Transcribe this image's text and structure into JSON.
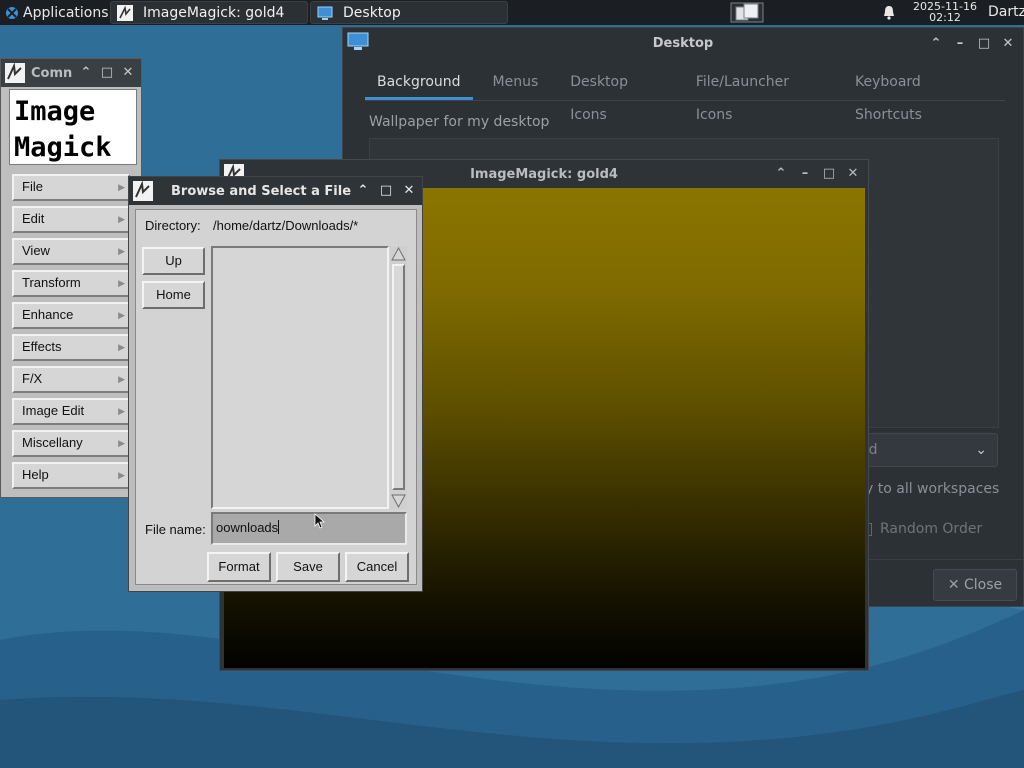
{
  "panel": {
    "applications_label": "Applications",
    "tasks": [
      {
        "label": "ImageMagick: gold4"
      },
      {
        "label": "Desktop"
      }
    ],
    "clock_date": "2025-11-16",
    "clock_time": "02:12",
    "user": "Dartz"
  },
  "desktop_window": {
    "title": "Desktop",
    "tabs": [
      "Background",
      "Menus",
      "Desktop Icons",
      "File/Launcher Icons",
      "Keyboard Shortcuts"
    ],
    "active_tab": "Background",
    "wallpaper_label": "Wallpaper for my desktop",
    "style_value": "ed",
    "apply_all_label": "y to all workspaces",
    "random_order_label": "Random Order",
    "close_label": "✕ Close"
  },
  "gold4_window": {
    "title": "ImageMagick: gold4"
  },
  "command_window": {
    "title": "Comn",
    "logo_lines": [
      "Image",
      "Magick"
    ],
    "menu_items": [
      "File",
      "Edit",
      "View",
      "Transform",
      "Enhance",
      "Effects",
      "F/X",
      "Image Edit",
      "Miscellany",
      "Help"
    ]
  },
  "browse_dialog": {
    "title": "Browse and Select a File",
    "directory_label": "Directory:",
    "directory_value": "/home/dartz/Downloads/*",
    "up_label": "Up",
    "home_label": "Home",
    "file_name_label": "File name:",
    "file_name_value": "oownloads",
    "format_label": "Format",
    "save_label": "Save",
    "cancel_label": "Cancel"
  },
  "colors": {
    "panel_bg": "#1b1f23",
    "desktop_bg": "#2f6e97",
    "accent": "#3d8fd6",
    "gold_top": "#8b7500"
  }
}
